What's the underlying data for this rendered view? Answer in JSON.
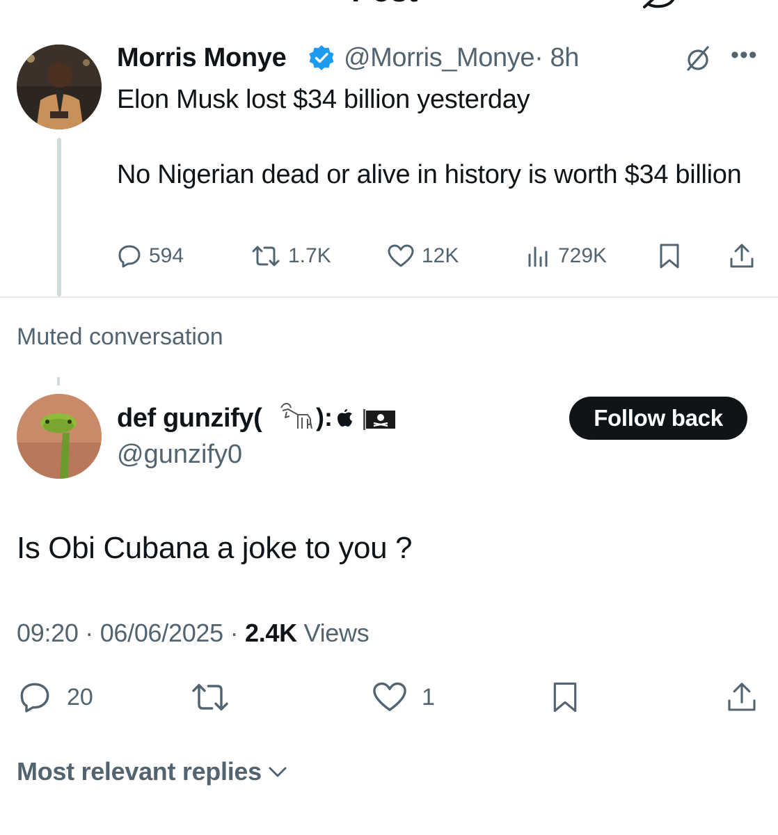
{
  "header": {
    "title": "Post"
  },
  "parent_post": {
    "name": "Morris Monye",
    "handle": "@Morris_Monye",
    "time": "· 8h",
    "text_line1": "Elon Musk lost $34 billion yesterday",
    "text_line2": "No Nigerian dead or alive in history is worth $34 billion",
    "stats": {
      "replies": "594",
      "reposts": "1.7K",
      "likes": "12K",
      "views": "729K"
    }
  },
  "muted_label": "Muted conversation",
  "main_post": {
    "name": "def gunzify(",
    "name_suffix": "):",
    "handle": "@gunzify0",
    "follow_label": "Follow back",
    "text": "Is Obi Cubana a joke to you ?",
    "time": "09:20",
    "date": "06/06/2025",
    "views_count": "2.4K",
    "views_label": "Views",
    "stats": {
      "replies": "20",
      "likes": "1"
    }
  },
  "replies_sort_label": "Most relevant replies",
  "colors": {
    "text": "#0f1419",
    "secondary": "#536471",
    "verified": "#1d9bf0",
    "divider": "#e7e7e7"
  }
}
